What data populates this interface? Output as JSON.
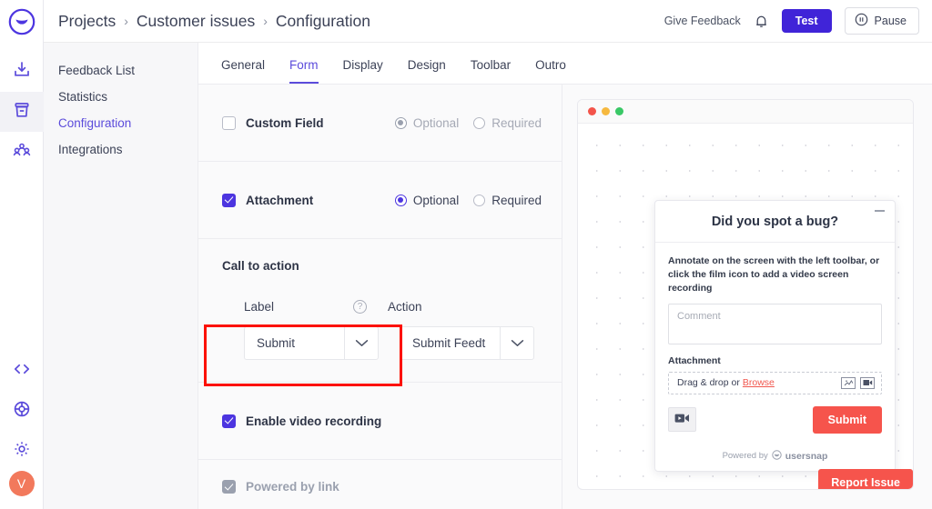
{
  "rail": {
    "logo_icon": "usersnap-logo-icon",
    "items": [
      {
        "icon": "download-inbox-icon",
        "name": "rail-item-inbox",
        "active": false
      },
      {
        "icon": "archive-box-icon",
        "name": "rail-item-projects",
        "active": true
      },
      {
        "icon": "team-people-icon",
        "name": "rail-item-team",
        "active": false
      },
      {
        "icon": "code-brackets-icon",
        "name": "rail-item-developers",
        "active": false
      },
      {
        "icon": "lifebuoy-help-icon",
        "name": "rail-item-help",
        "active": false
      },
      {
        "icon": "gear-settings-icon",
        "name": "rail-item-settings",
        "active": false
      }
    ],
    "avatar_initial": "V"
  },
  "topbar": {
    "breadcrumb": [
      "Projects",
      "Customer issues",
      "Configuration"
    ],
    "separator": "›",
    "give_feedback_label": "Give Feedback",
    "bell_icon": "bell-notification-icon",
    "test_label": "Test",
    "pause_label": "Pause",
    "pause_icon": "pause-circle-icon"
  },
  "sidenav": {
    "items": [
      {
        "label": "Feedback List",
        "active": false
      },
      {
        "label": "Statistics",
        "active": false
      },
      {
        "label": "Configuration",
        "active": true
      },
      {
        "label": "Integrations",
        "active": false
      }
    ]
  },
  "tabs": [
    {
      "label": "General",
      "active": false
    },
    {
      "label": "Form",
      "active": true
    },
    {
      "label": "Display",
      "active": false
    },
    {
      "label": "Design",
      "active": false
    },
    {
      "label": "Toolbar",
      "active": false
    },
    {
      "label": "Outro",
      "active": false
    }
  ],
  "settings": {
    "custom_field": {
      "label": "Custom Field",
      "checked": false,
      "optional_label": "Optional",
      "required_label": "Required",
      "selected": "Optional"
    },
    "attachment": {
      "label": "Attachment",
      "checked": true,
      "optional_label": "Optional",
      "required_label": "Required",
      "selected": "Optional"
    },
    "call_to_action": {
      "title": "Call to action",
      "label_header": "Label",
      "action_header": "Action",
      "help_icon": "question-mark-help-icon",
      "label_value": "Submit",
      "action_value": "Submit Feedt",
      "chevron_icon": "chevron-down-icon"
    },
    "enable_video_recording": {
      "label": "Enable video recording",
      "checked": true,
      "highlight_color": "#fc1100"
    },
    "powered_by_link": {
      "label": "Powered by link",
      "checked": true,
      "disabled": true
    }
  },
  "preview": {
    "window_dots": [
      "#f3544a",
      "#f6b93f",
      "#39c866"
    ],
    "widget": {
      "title": "Did you spot a bug?",
      "minimize_icon": "minimize-icon",
      "help_text": "Annotate on the screen with the left toolbar, or click the film icon to add a video screen recording",
      "comment_placeholder": "Comment",
      "attachment_label": "Attachment",
      "drop_text": "Drag & drop or",
      "browse_label": "Browse",
      "image_icon": "image-attachment-icon",
      "video_icon": "video-attachment-icon",
      "record_icon": "video-camera-icon",
      "submit_label": "Submit",
      "powered_by_text": "Powered by",
      "powered_by_brand": "usersnap",
      "brand_icon": "usersnap-logo-icon",
      "accent_color": "#f6544c"
    },
    "report_button_label": "Report Issue"
  }
}
